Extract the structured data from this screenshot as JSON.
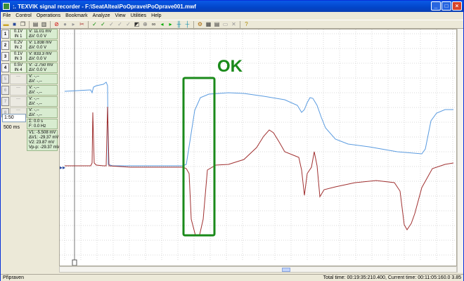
{
  "window": {
    "title": ":. TEXVIK  signal recorder - F:\\SeatAltea\\PoOprave\\PoOprave001.mwf",
    "buttons": {
      "minimize": "_",
      "maximize": "□",
      "close": "×"
    }
  },
  "menu": [
    "File",
    "Control",
    "Operations",
    "Bookmark",
    "Analyze",
    "View",
    "Utilities",
    "Help"
  ],
  "toolbar_icons": [
    "open-icon",
    "save-icon",
    "copy-icon",
    "print-icon",
    "print-preview-icon",
    "stop-record-icon",
    "record-icon",
    "play-icon",
    "cut-icon",
    "check-icon",
    "check-multi-icon",
    "check-alt-icon",
    "check-gray-icon",
    "check-gray2-icon",
    "color-icon",
    "zoom-icon",
    "binoculars-icon",
    "arrow-left-icon",
    "arrow-right-icon",
    "cursor-icon",
    "cursor-dropdown-icon",
    "settings-icon",
    "grid-icon",
    "table-icon",
    "sheet-icon",
    "delete-icon",
    "help-icon"
  ],
  "channels": [
    {
      "btn": "1",
      "sens": "0.1V",
      "input": "IN 1",
      "v": "V: 11.01 mV",
      "d": "ΔV:   0.0 V"
    },
    {
      "btn": "2",
      "sens": "0.2V",
      "input": "IN 2",
      "v": "V: 1.838 mV",
      "d": "ΔV:   0.0 V"
    },
    {
      "btn": "3",
      "sens": "0.1V",
      "input": "IN 3",
      "v": "V: 833.3 mV",
      "d": "ΔV:   0.0 V"
    },
    {
      "btn": "4",
      "sens": "0.5V",
      "input": "IN 4",
      "v": "V: -2.750 mV",
      "d": "ΔV:   0.0 V"
    },
    {
      "btn": "5",
      "sens": "---",
      "input": "---",
      "v": "V:  -,--",
      "d": "ΔV:  -,--"
    },
    {
      "btn": "6",
      "sens": "---",
      "input": "---",
      "v": "V:  -,--",
      "d": "ΔV:  -,--"
    },
    {
      "btn": "7",
      "sens": "---",
      "input": "---",
      "v": "V:  -,--",
      "d": "ΔV:  -,--"
    },
    {
      "btn": "8",
      "sens": "---",
      "input": "---",
      "v": "V:  -,--",
      "d": "ΔV:  -,--"
    }
  ],
  "timebase": {
    "ratio": "1:50",
    "span": "500 ms"
  },
  "measurements": {
    "dt": "Σ:   0.0 s",
    "freq": "F:   0.0 Hz",
    "v1": "V1: -5.508 mV",
    "dv1": "ΔV1: -29.37 mV",
    "v2": "V2: 23.87 mV",
    "vpp": "Vp-p: -29.37 mV"
  },
  "annotation": {
    "label": "OK",
    "color": "#1a8a1a"
  },
  "colors": {
    "blue_trace": "#5a9be0",
    "red_trace": "#a03030",
    "grid": "#d8d8d8"
  },
  "status": {
    "left": "Připraven",
    "right": "Total time: 00:19:35:210.400,  Current time: 00:11:05:160.0  3.85"
  }
}
